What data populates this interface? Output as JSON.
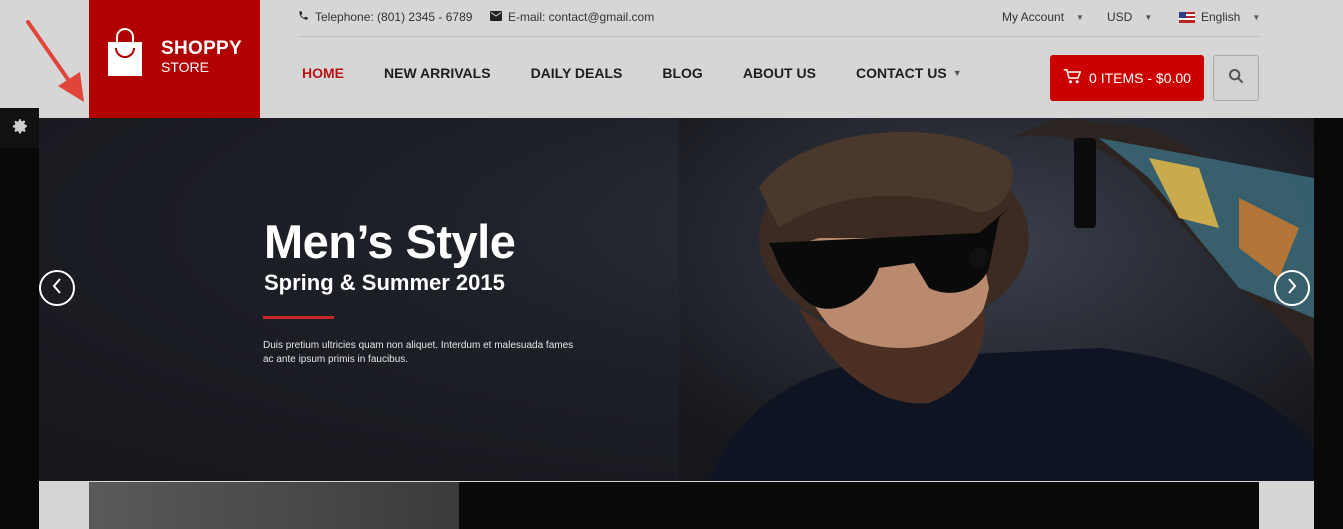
{
  "topbar": {
    "telephone": "Telephone: (801) 2345 - 6789",
    "email": "E-mail: contact@gmail.com",
    "account": "My Account",
    "currency": "USD",
    "language": "English"
  },
  "logo": {
    "brand": "SHOPPY",
    "sub": "STORE"
  },
  "nav": {
    "home": "HOME",
    "new_arrivals": "NEW ARRIVALS",
    "daily_deals": "DAILY DEALS",
    "blog": "BLOG",
    "about": "ABOUT US",
    "contact": "CONTACT US"
  },
  "cart": {
    "label": "0 ITEMS - $0.00"
  },
  "hero": {
    "title": "Men’s Style",
    "subtitle": "Spring & Summer 2015",
    "description": "Duis pretium ultricies quam non aliquet. Interdum et malesuada fames ac ante ipsum primis in faucibus."
  },
  "colors": {
    "brand_red": "#b20101",
    "accent_red": "#c00000",
    "nav_active": "#b71515"
  },
  "icons": [
    "phone-icon",
    "envelope-icon",
    "flag-icon",
    "cart-icon",
    "search-icon",
    "gear-icon",
    "chevron-left-icon",
    "chevron-right-icon",
    "annotation-arrow"
  ]
}
